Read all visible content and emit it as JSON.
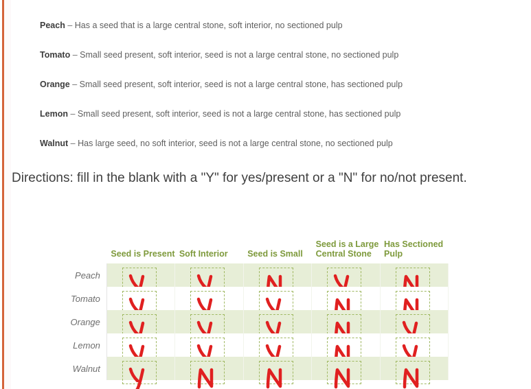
{
  "accent_color": "#d4633a",
  "header_color": "#7e9a3c",
  "ink_color": "#e02020",
  "stripe_color": "#e7eed7",
  "descriptions": [
    {
      "term": "Peach",
      "dash": "–",
      "body": "Has a seed that is a large central stone, soft interior, no sectioned pulp"
    },
    {
      "term": "Tomato",
      "dash": "–",
      "body": "Small seed present, soft interior, seed is not a large central stone, no sectioned pulp"
    },
    {
      "term": "Orange",
      "dash": "–",
      "body": "Small seed present, soft interior, seed is not a large central stone, has sectioned pulp"
    },
    {
      "term": "Lemon",
      "dash": "–",
      "body": "Small seed present, soft interior, seed is not a large central stone, has sectioned pulp"
    },
    {
      "term": "Walnut",
      "dash": "–",
      "body": "Has large seed, no soft interior, seed is not a large central stone, no sectioned pulp"
    }
  ],
  "directions": "Directions: fill in the blank with a \"Y\" for yes/present or a \"N\" for no/not present.",
  "table": {
    "corner_label": "",
    "columns": [
      "Seed is Present",
      "Soft Interior",
      "Seed is Small",
      "Seed is a Large Central Stone",
      "Has Sectioned Pulp"
    ],
    "rows": [
      {
        "label": "Peach",
        "answers": [
          "Y",
          "Y",
          "N",
          "Y",
          "N"
        ]
      },
      {
        "label": "Tomato",
        "answers": [
          "Y",
          "Y",
          "Y",
          "N",
          "N"
        ]
      },
      {
        "label": "Orange",
        "answers": [
          "Y",
          "Y",
          "Y",
          "N",
          "Y"
        ]
      },
      {
        "label": "Lemon",
        "answers": [
          "Y",
          "Y",
          "Y",
          "N",
          "Y"
        ]
      },
      {
        "label": "Walnut",
        "answers": [
          "Y",
          "N",
          "N",
          "N",
          "N"
        ]
      }
    ]
  }
}
